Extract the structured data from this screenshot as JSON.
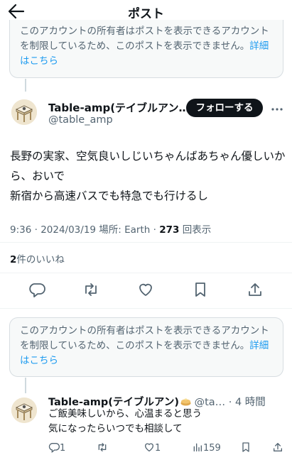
{
  "header": {
    "title": "ポスト"
  },
  "notice_top": {
    "text": "このアカウントの所有者はポストを表示できるアカウントを制限しているため、このポストを表示できません。",
    "link": "詳細はこちら"
  },
  "post": {
    "display_name": "Table-amp(テイブルアン…",
    "handle": "@table_amp",
    "follow_label": "フォローする",
    "body_line1": "長野の実家、空気良いしじいちゃんばあちゃん優しいから、おいで",
    "body_line2": "新宿から高速バスでも特急でも行けるし",
    "meta_time": "9:36 · 2024/03/19 場所: Earth · ",
    "views_count": "273",
    "views_label": "回表示",
    "likes_count": "2",
    "likes_label": "件のいいね"
  },
  "notice_bottom": {
    "text": "このアカウントの所有者はポストを表示できるアカウントを制限しているため、このポストを表示できません。",
    "link": "詳細はこちら"
  },
  "reply": {
    "display_name": "Table-amp(テイブルアン)",
    "handle_time": " @ta… · 4 時間",
    "line1": "ご飯美味しいから、心温まると思う",
    "line2": "気になったらいつでも相談して",
    "reply_count": "1",
    "retweet_count": "",
    "like_count": "1",
    "view_count": "159"
  },
  "icons": {
    "back": "arrow-left-icon",
    "more": "more-dots-icon",
    "reply": "reply-bubble-icon",
    "retweet": "retweet-icon",
    "like": "heart-icon",
    "bookmark": "bookmark-icon",
    "share": "share-icon",
    "views": "views-bars-icon"
  },
  "colors": {
    "link": "#1d9bf0",
    "text": "#0f1419",
    "muted": "#536471",
    "follow_bg": "#0f1419"
  }
}
